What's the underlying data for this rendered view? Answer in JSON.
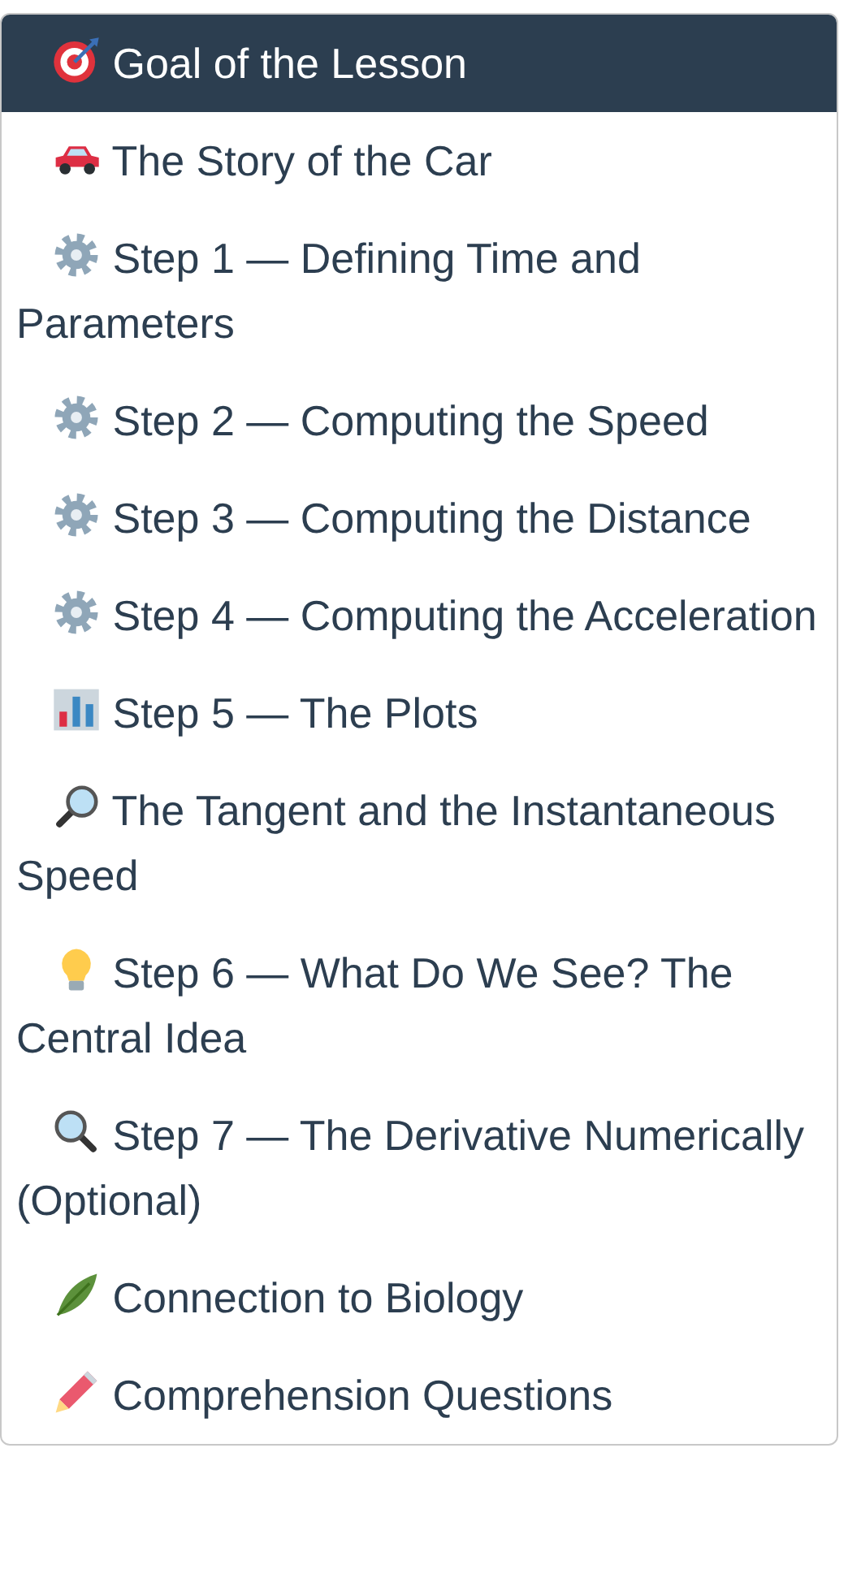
{
  "toc": {
    "items": [
      {
        "kind": "goal",
        "label": "Goal of the Lesson",
        "selected": true
      },
      {
        "kind": "story",
        "label": "The Story of the Car",
        "selected": false
      },
      {
        "kind": "step",
        "label": "Step 1 — Defining Time and Parameters",
        "selected": false
      },
      {
        "kind": "step",
        "label": "Step 2 — Computing the Speed",
        "selected": false
      },
      {
        "kind": "step",
        "label": "Step 3 — Computing the Distance",
        "selected": false
      },
      {
        "kind": "step",
        "label": "Step 4 — Computing the Acceleration",
        "selected": false
      },
      {
        "kind": "plots",
        "label": "Step 5 — The Plots",
        "selected": false
      },
      {
        "kind": "tangent",
        "label": "The Tangent and the Instantaneous Speed",
        "selected": false
      },
      {
        "kind": "idea",
        "label": "Step 6 — What Do We See? The Central Idea",
        "selected": false
      },
      {
        "kind": "derivative",
        "label": "Step 7 — The Derivative Numerically (Optional)",
        "selected": false
      },
      {
        "kind": "biology",
        "label": "Connection to Biology",
        "selected": false
      },
      {
        "kind": "questions",
        "label": "Comprehension Questions",
        "selected": false
      }
    ]
  }
}
